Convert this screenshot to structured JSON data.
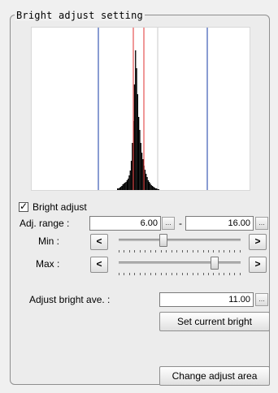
{
  "group": {
    "title": "Bright adjust setting"
  },
  "bright_adjust": {
    "label": "Bright adjust",
    "checked": true,
    "check_glyph": "✓"
  },
  "adj_range": {
    "label": "Adj. range :",
    "low": "6.00",
    "high": "16.00",
    "separator": "-"
  },
  "min": {
    "label": "Min :",
    "dec": "<",
    "inc": ">",
    "level": 0.36
  },
  "max": {
    "label": "Max :",
    "dec": "<",
    "inc": ">",
    "level": 0.81
  },
  "adjust_ave": {
    "label": "Adjust bright ave. :",
    "value": "11.00"
  },
  "ellipsis": "...",
  "buttons": {
    "set_current": "Set current bright",
    "change_area": "Change adjust area"
  },
  "histogram": {
    "line_colors": {
      "blue": "#3b5bb5",
      "red": "#e03030",
      "light": "#c9c9c9"
    },
    "bar_heights": [
      2,
      2,
      3,
      4,
      5,
      7,
      8,
      9,
      10,
      12,
      14,
      18,
      24,
      36,
      58,
      85,
      130,
      172,
      150,
      118,
      90,
      74,
      58,
      46,
      38,
      30,
      25,
      20,
      16,
      12,
      10,
      8,
      6,
      5,
      4,
      3,
      2,
      2,
      1,
      1
    ]
  }
}
